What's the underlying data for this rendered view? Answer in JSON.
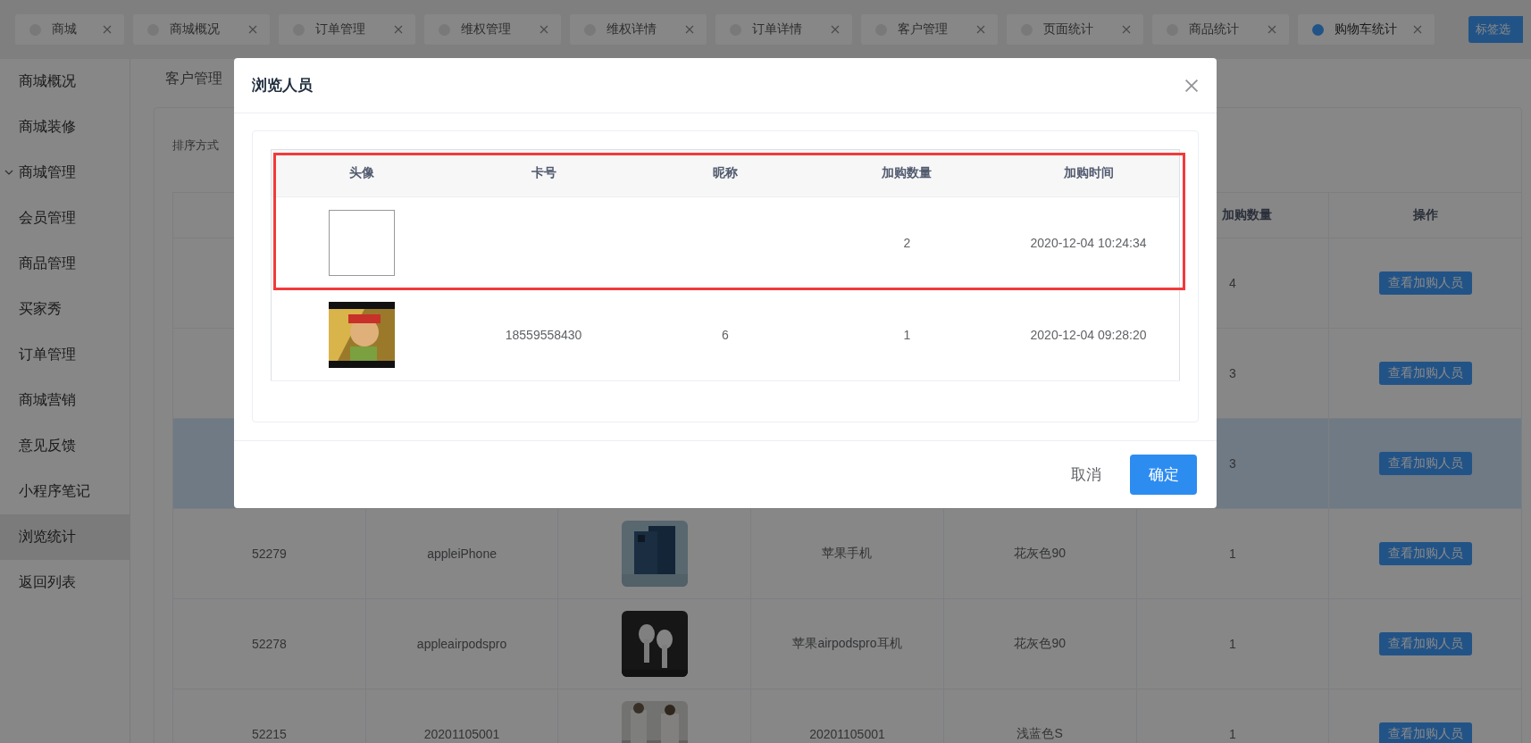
{
  "tabs": [
    {
      "label": "商城",
      "selected": false
    },
    {
      "label": "商城概况",
      "selected": false
    },
    {
      "label": "订单管理",
      "selected": false
    },
    {
      "label": "维权管理",
      "selected": false
    },
    {
      "label": "维权详情",
      "selected": false
    },
    {
      "label": "订单详情",
      "selected": false
    },
    {
      "label": "客户管理",
      "selected": false
    },
    {
      "label": "页面统计",
      "selected": false
    },
    {
      "label": "商品统计",
      "selected": false
    },
    {
      "label": "购物车统计",
      "selected": true
    }
  ],
  "tab_options_button": "标签选",
  "sidebar": {
    "items": [
      {
        "label": "商城概况",
        "selected": false,
        "kind": "link"
      },
      {
        "label": "商城装修",
        "selected": false,
        "kind": "link"
      },
      {
        "label": "商城管理",
        "selected": false,
        "kind": "group",
        "expanded": true
      },
      {
        "label": "会员管理",
        "selected": false,
        "kind": "link"
      },
      {
        "label": "商品管理",
        "selected": false,
        "kind": "link"
      },
      {
        "label": "买家秀",
        "selected": false,
        "kind": "link"
      },
      {
        "label": "订单管理",
        "selected": false,
        "kind": "link"
      },
      {
        "label": "商城营销",
        "selected": false,
        "kind": "link"
      },
      {
        "label": "意见反馈",
        "selected": false,
        "kind": "link"
      },
      {
        "label": "小程序笔记",
        "selected": false,
        "kind": "link"
      },
      {
        "label": "浏览统计",
        "selected": true,
        "kind": "link"
      },
      {
        "label": "返回列表",
        "selected": false,
        "kind": "link"
      }
    ]
  },
  "breadcrumb": "客户管理",
  "sort_label": "排序方式",
  "table": {
    "columns": {
      "column_6": "加购数量",
      "column_7": "操作"
    },
    "rows": [
      {
        "column_6": "4",
        "action_button": "查看加购人员",
        "hovered": false
      },
      {
        "column_6": "3",
        "action_button": "查看加购人员",
        "hovered": false
      },
      {
        "column_6": "3",
        "action_button": "查看加购人员",
        "hovered": true
      },
      {
        "column_1": "52279",
        "column_2": "appleiPhone",
        "column_4": "苹果手机",
        "column_5": "花灰色90",
        "column_6": "1",
        "action_button": "查看加购人员",
        "hovered": false
      },
      {
        "column_1": "52278",
        "column_2": "appleairpodspro",
        "column_4": "苹果airpodspro耳机",
        "column_5": "花灰色90",
        "column_6": "1",
        "action_button": "查看加购人员",
        "hovered": false
      },
      {
        "column_1": "52215",
        "column_2": "20201105001",
        "column_4": "20201105001",
        "column_5": "浅蓝色S",
        "column_6": "1",
        "action_button": "查看加购人员",
        "hovered": false
      }
    ]
  },
  "modal": {
    "title": "浏览人员",
    "columns": [
      "头像",
      "卡号",
      "昵称",
      "加购数量",
      "加购时间"
    ],
    "rows": [
      {
        "avatar": {
          "kind": "blank"
        },
        "quantity": "2",
        "time": "2020-12-04 10:24:34",
        "highlighted": true
      },
      {
        "card_no": "18559558430",
        "nickname": "6",
        "quantity": "1",
        "time": "2020-12-04 09:28:20",
        "highlighted": false
      }
    ],
    "buttons": [
      {
        "label": "取消",
        "kind": "text"
      },
      {
        "label": "确定",
        "kind": "primary"
      }
    ]
  }
}
